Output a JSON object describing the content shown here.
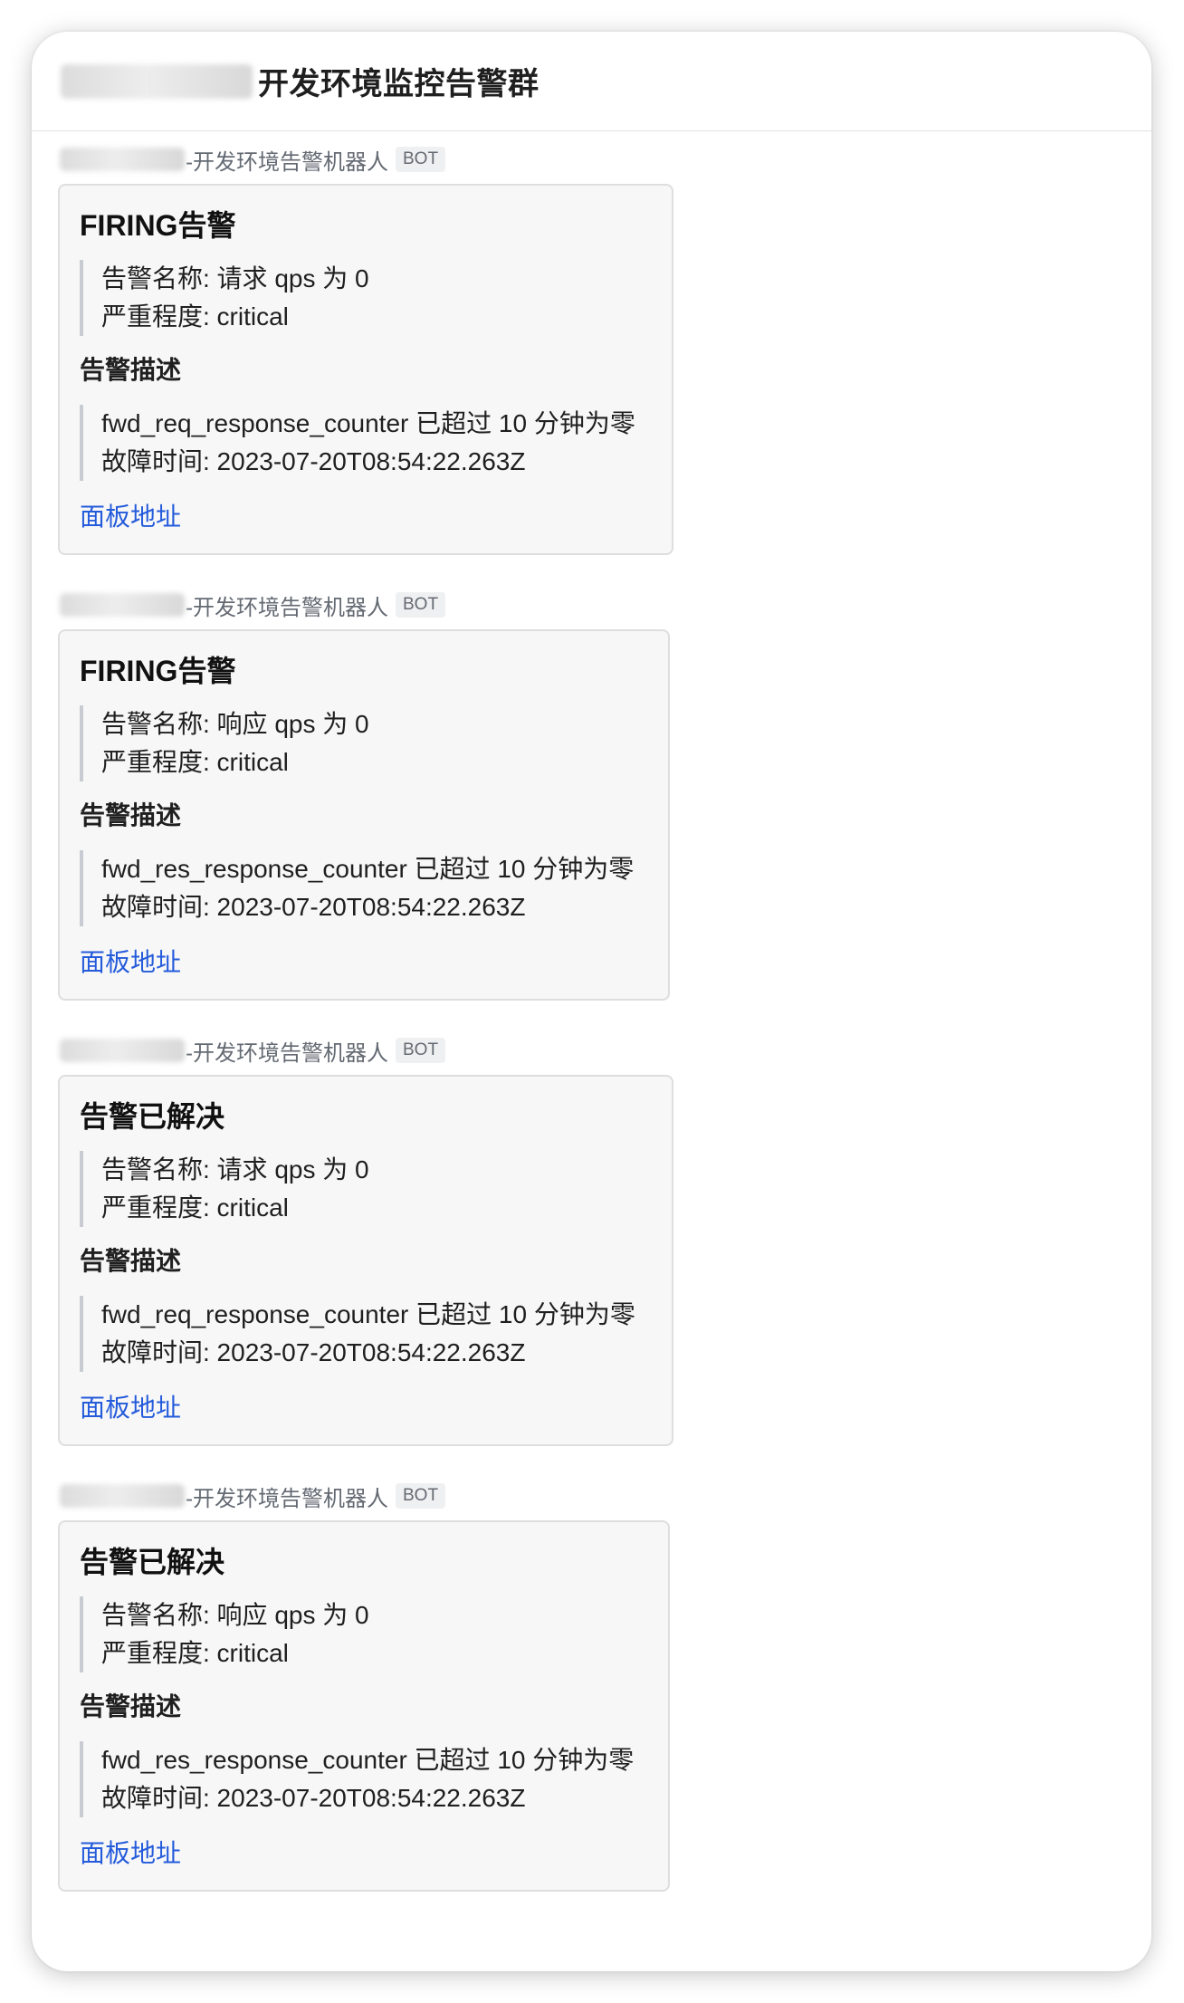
{
  "group": {
    "title": "开发环境监控告警群"
  },
  "messages": [
    {
      "sender_suffix": "-开发环境告警机器人",
      "bot_tag": "BOT",
      "card": {
        "title": "FIRING告警",
        "alert_name": "告警名称: 请求 qps 为 0",
        "severity": "严重程度: critical",
        "desc_title": "告警描述",
        "desc_line": "fwd_req_response_counter 已超过 10 分钟为零",
        "fault_time": "故障时间: 2023-07-20T08:54:22.263Z",
        "link": "面板地址"
      }
    },
    {
      "sender_suffix": "-开发环境告警机器人",
      "bot_tag": "BOT",
      "card": {
        "title": "FIRING告警",
        "alert_name": "告警名称: 响应 qps 为 0",
        "severity": "严重程度: critical",
        "desc_title": "告警描述",
        "desc_line": "fwd_res_response_counter 已超过 10 分钟为零",
        "fault_time": "故障时间: 2023-07-20T08:54:22.263Z",
        "link": "面板地址"
      }
    },
    {
      "sender_suffix": "-开发环境告警机器人",
      "bot_tag": "BOT",
      "card": {
        "title": "告警已解决",
        "alert_name": "告警名称: 请求 qps 为 0",
        "severity": "严重程度: critical",
        "desc_title": "告警描述",
        "desc_line": "fwd_req_response_counter 已超过 10 分钟为零",
        "fault_time": "故障时间: 2023-07-20T08:54:22.263Z",
        "link": "面板地址"
      }
    },
    {
      "sender_suffix": "-开发环境告警机器人",
      "bot_tag": "BOT",
      "card": {
        "title": "告警已解决",
        "alert_name": "告警名称: 响应 qps 为 0",
        "severity": "严重程度: critical",
        "desc_title": "告警描述",
        "desc_line": "fwd_res_response_counter 已超过 10 分钟为零",
        "fault_time": "故障时间: 2023-07-20T08:54:22.263Z",
        "link": "面板地址"
      }
    }
  ],
  "colors": {
    "link": "#245bdb",
    "card_background": "#f7f7f7",
    "card_border": "#dedede",
    "quote_bar": "#c8cbd1",
    "muted_text": "#646a73"
  }
}
